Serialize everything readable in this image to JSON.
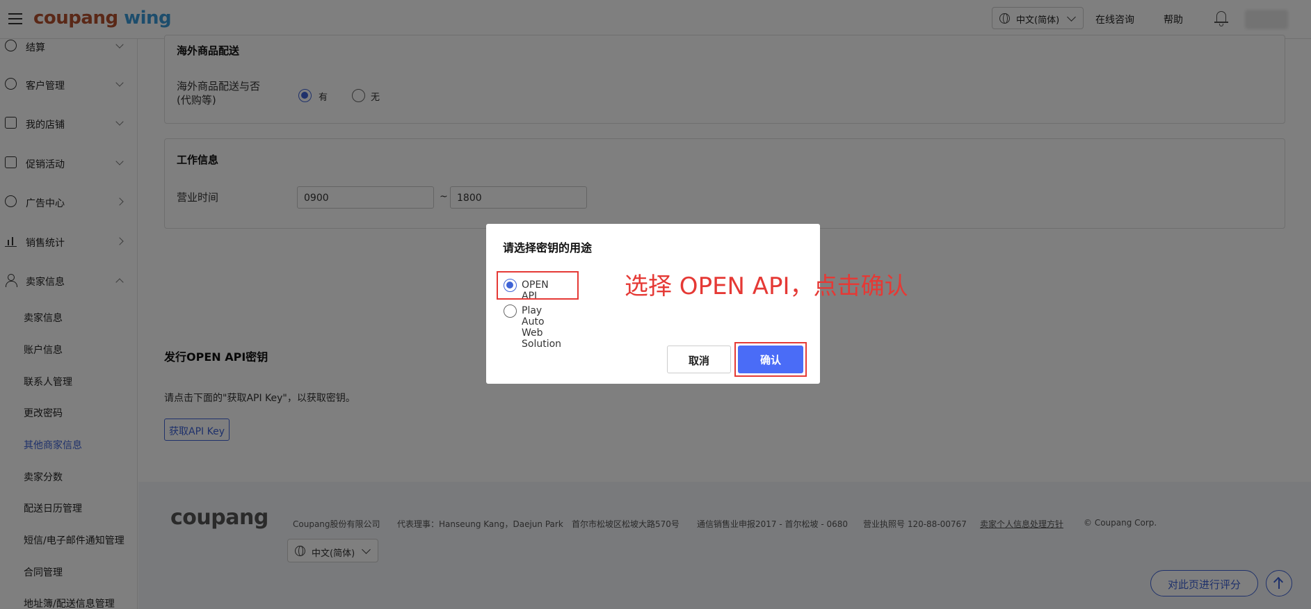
{
  "header": {
    "logo_part1": "coupang",
    "logo_part2": " wing",
    "language": "中文(简体)",
    "online_consult": "在线咨询",
    "help": "帮助"
  },
  "sidebar": {
    "items": [
      {
        "label": "结算"
      },
      {
        "label": "客户管理"
      },
      {
        "label": "我的店铺"
      },
      {
        "label": "促销活动"
      },
      {
        "label": "广告中心"
      },
      {
        "label": "销售统计"
      },
      {
        "label": "卖家信息"
      }
    ],
    "sub_items": [
      "卖家信息",
      "账户信息",
      "联系人管理",
      "更改密码",
      "其他商家信息",
      "卖家分数",
      "配送日历管理",
      "短信/电子邮件通知管理",
      "合同管理",
      "地址簿/配送信息管理"
    ]
  },
  "main": {
    "overseas": {
      "title": "海外商品配送",
      "label_line1": "海外商品配送与否",
      "label_line2": "(代购等)",
      "opt_yes": "有",
      "opt_no": "无"
    },
    "work": {
      "title": "工作信息",
      "label": "营业时间",
      "start": "0900",
      "sep": "~",
      "end": "1800"
    },
    "api": {
      "title": "发行OPEN API密钥",
      "desc": "请点击下面的\"获取API Key\"，以获取密钥。",
      "button": "获取API Key"
    }
  },
  "footer": {
    "logo": "coupang",
    "company": "Coupang股份有限公司",
    "ceo": "代表理事：Hanseung Kang，Daejun Park",
    "address": "首尔市松坡区松坡大路570号",
    "telecom": "通信销售业申报2017 - 首尔松坡 - 0680",
    "biz_no": "营业执照号 120-88-00767",
    "privacy": "卖家个人信息处理方针",
    "copyright": "© Coupang Corp.",
    "language": "中文(简体)",
    "rate_button": "对此页进行评分"
  },
  "modal": {
    "title": "请选择密钥的用途",
    "options": [
      "OPEN API",
      "Play Auto Web Solution"
    ],
    "selected": "OPEN API",
    "cancel": "取消",
    "confirm": "确认"
  },
  "annotation": "选择 OPEN API，点击确认",
  "colors": {
    "accent": "#3e63d6",
    "confirm_button": "#4a6cf7",
    "highlight_red": "#e53935",
    "logo_brown": "#b5512f",
    "logo_blue": "#3a9ad9"
  }
}
